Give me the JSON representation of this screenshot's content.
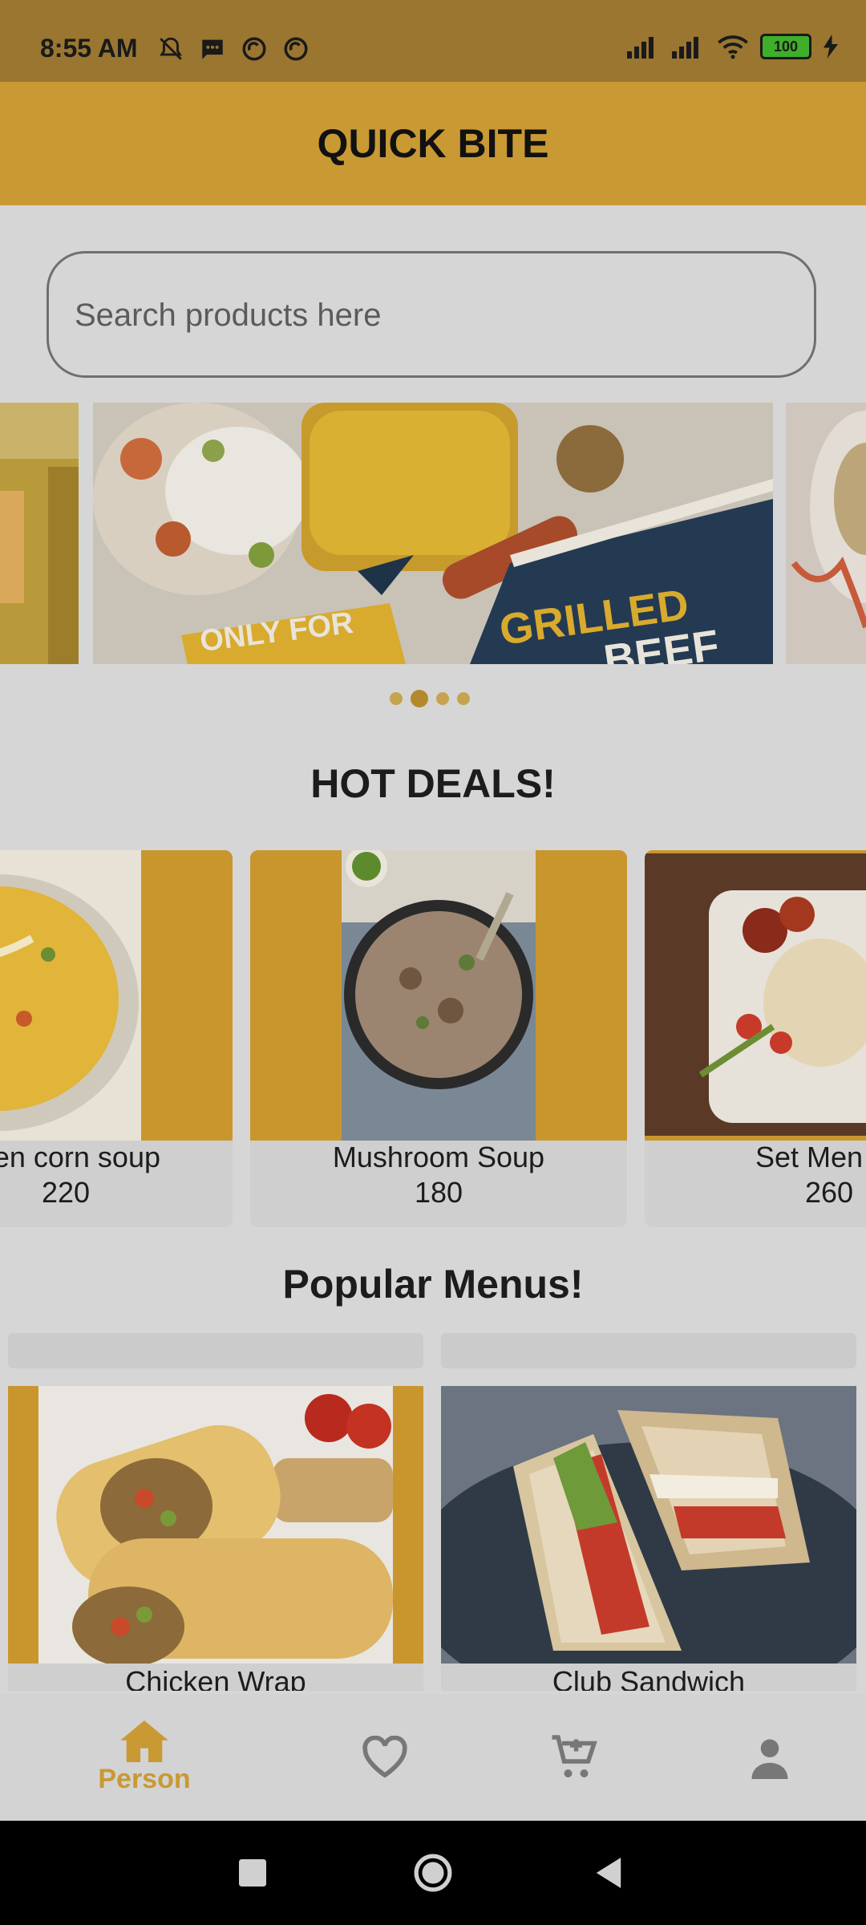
{
  "status_bar": {
    "time": "8:55 AM",
    "battery": "100"
  },
  "app": {
    "title": "QUICK BITE"
  },
  "search": {
    "placeholder": "Search products here"
  },
  "carousel": {
    "slide_texts": {
      "only_for": "ONLY FOR",
      "grilled": "GRILLED",
      "beef": "BEEF"
    }
  },
  "hot_deals": {
    "title": "HOT DEALS!",
    "items": [
      {
        "name": "en corn soup",
        "price": "220"
      },
      {
        "name": "Mushroom Soup",
        "price": "180"
      },
      {
        "name": "Set Men",
        "price": "260"
      }
    ]
  },
  "popular": {
    "title": "Popular Menus!",
    "items": [
      {
        "name": "Chicken Wrap"
      },
      {
        "name": "Club Sandwich"
      }
    ]
  },
  "bottom_nav": {
    "items": [
      {
        "label": "Person",
        "icon": "home-icon",
        "active": true
      },
      {
        "label": "",
        "icon": "heart-icon"
      },
      {
        "label": "",
        "icon": "cart-add-icon"
      },
      {
        "label": "",
        "icon": "person-icon"
      }
    ]
  },
  "colors": {
    "accent": "#c99934",
    "status_bar": "#9a7630",
    "background": "#d6d6d6"
  }
}
